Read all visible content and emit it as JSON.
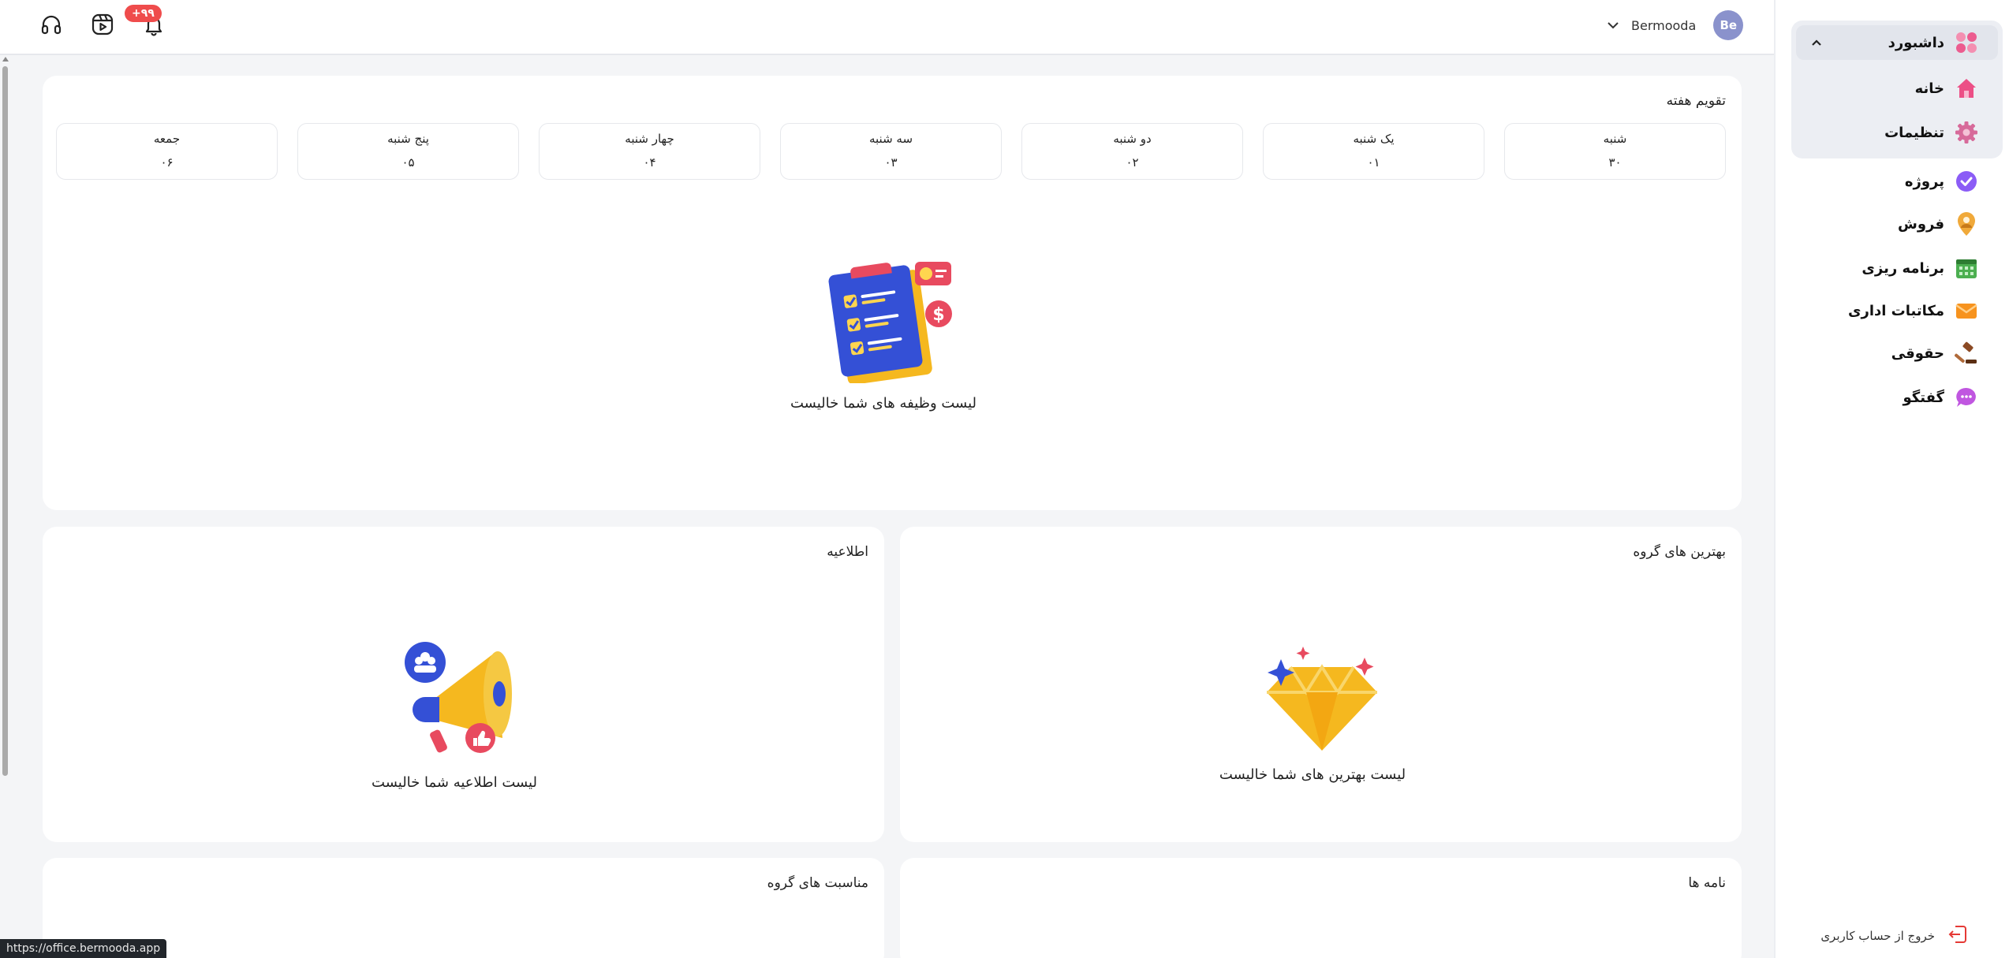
{
  "header": {
    "notification_count": "+۹۹",
    "user_name": "Bermooda",
    "avatar_initials": "Be",
    "icons": [
      "headphones-icon",
      "video-icon",
      "bell-icon"
    ]
  },
  "sidebar": {
    "dashboard": {
      "label": "داشبورد",
      "icon": "apps-icon",
      "color": "#ec5c8f"
    },
    "sub_items": [
      {
        "label": "خانه",
        "icon": "home-icon",
        "color": "#ec4f86"
      },
      {
        "label": "تنظیمات",
        "icon": "gear-icon",
        "color": "#d76a9a"
      }
    ],
    "items": [
      {
        "label": "پروژه",
        "icon": "check-circle-icon",
        "color": "#8b5cf6"
      },
      {
        "label": "فروش",
        "icon": "location-pin-icon",
        "color": "#f0a93a"
      },
      {
        "label": "برنامه ریزی",
        "icon": "calendar-icon",
        "color": "#4caf50"
      },
      {
        "label": "مکاتبات اداری",
        "icon": "envelope-icon",
        "color": "#f7931e"
      },
      {
        "label": "حقوقی",
        "icon": "gavel-icon",
        "color": "#8b4a24"
      },
      {
        "label": "گفتگو",
        "icon": "chat-bubble-icon",
        "color": "#c056e0"
      }
    ],
    "logout_label": "خروج از حساب کاربری"
  },
  "week_calendar": {
    "title": "تقویم هفته",
    "days": [
      {
        "name": "شنبه",
        "date": "۳۰"
      },
      {
        "name": "یک شنبه",
        "date": "۰۱"
      },
      {
        "name": "دو شنبه",
        "date": "۰۲"
      },
      {
        "name": "سه شنبه",
        "date": "۰۳"
      },
      {
        "name": "چهار شنبه",
        "date": "۰۴"
      },
      {
        "name": "پنج شنبه",
        "date": "۰۵"
      },
      {
        "name": "جمعه",
        "date": "۰۶"
      }
    ],
    "empty_text": "لیست وظیفه های شما خالیست"
  },
  "announcements": {
    "title": "اطلاعیه",
    "empty_text": "لیست اطلاعیه شما خالیست"
  },
  "best_of_group": {
    "title": "بهترین های گروه",
    "empty_text": "لیست بهترین های شما خالیست"
  },
  "group_occasions": {
    "title": "مناسبت های گروه"
  },
  "letters": {
    "title": "نامه ها"
  },
  "status_bar_url": "https://office.bermooda.app"
}
